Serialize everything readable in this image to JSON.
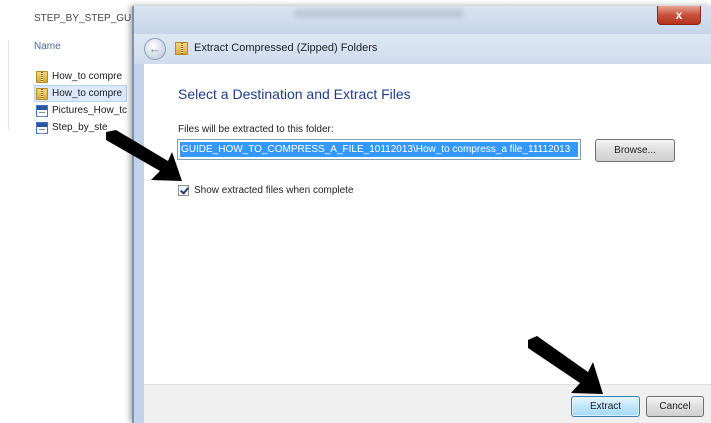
{
  "explorer": {
    "breadcrumb": "STEP_BY_STEP_GUID",
    "column_header": "Name",
    "files": [
      {
        "name": "How_to compre",
        "icon": "zip-folder-icon"
      },
      {
        "name": "How_to compre",
        "icon": "zip-folder-icon",
        "selected": true
      },
      {
        "name": "Pictures_How_tc",
        "icon": "word-document-icon"
      },
      {
        "name": "Step_by_ste",
        "icon": "word-document-icon"
      }
    ]
  },
  "dialog": {
    "close_label": "x",
    "back_icon": "back-arrow-icon",
    "title_icon": "zip-folder-icon",
    "title": "Extract Compressed (Zipped) Folders",
    "heading": "Select a Destination and Extract Files",
    "path_label": "Files will be extracted to this folder:",
    "path_value": "GUIDE_HOW_TO_COMPRESS_A_FILE_10112013\\How_to compress_a file_11112013",
    "browse_label": "Browse...",
    "show_files_label": "Show extracted files when complete",
    "show_files_checked": true,
    "extract_label": "Extract",
    "cancel_label": "Cancel"
  },
  "colors": {
    "heading": "#1e3f8a",
    "selection": "#3399ff",
    "close_button": "#c7503d",
    "arrow": "#000000"
  }
}
